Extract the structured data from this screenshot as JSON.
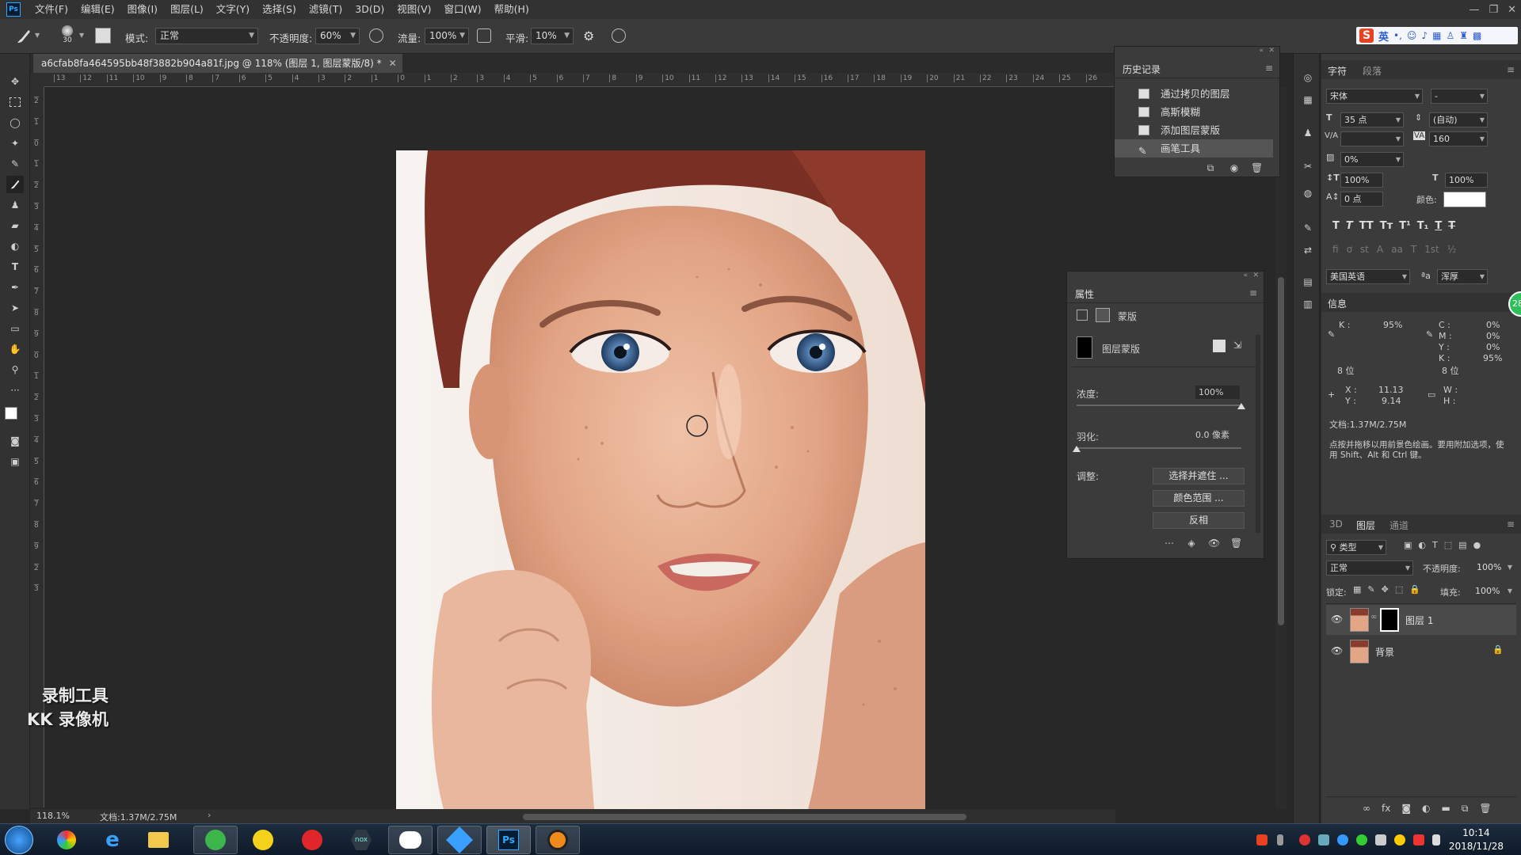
{
  "menubar": {
    "logo": "Ps",
    "items": [
      "文件(F)",
      "编辑(E)",
      "图像(I)",
      "图层(L)",
      "文字(Y)",
      "选择(S)",
      "滤镜(T)",
      "3D(D)",
      "视图(V)",
      "窗口(W)",
      "帮助(H)"
    ],
    "minimize": "—",
    "restore": "❐",
    "close": "✕"
  },
  "options": {
    "brush_size": "30",
    "mode_label": "模式:",
    "mode_value": "正常",
    "opacity_label": "不透明度:",
    "opacity_value": "60%",
    "flow_label": "流量:",
    "flow_value": "100%",
    "smooth_label": "平滑:",
    "smooth_value": "10%"
  },
  "ime": {
    "lang": "英"
  },
  "document": {
    "tab_title": "a6cfab8fa464595bb48f3882b904a81f.jpg @ 118% (图层 1, 图层蒙版/8) *",
    "zoom": "118.1%",
    "doc_size": "文档:1.37M/2.75M"
  },
  "rulers": {
    "h": [
      "13",
      "12",
      "11",
      "10",
      "9",
      "8",
      "7",
      "6",
      "5",
      "4",
      "3",
      "2",
      "1",
      "0",
      "1",
      "2",
      "3",
      "4",
      "5",
      "6",
      "7",
      "8",
      "9",
      "10",
      "11",
      "12",
      "13",
      "14",
      "15",
      "16",
      "17",
      "18",
      "19",
      "20",
      "21",
      "22",
      "23",
      "24",
      "25",
      "26"
    ],
    "v": [
      "2",
      "1",
      "0",
      "1",
      "2",
      "3",
      "4",
      "5",
      "6",
      "7",
      "8",
      "9",
      "0",
      "1",
      "2",
      "3",
      "4",
      "5",
      "6",
      "7",
      "8",
      "9",
      "2",
      "3"
    ]
  },
  "watermark": {
    "line1": "录制工具",
    "line2": "KK 录像机"
  },
  "history": {
    "title": "历史记录",
    "items": [
      "通过拷贝的图层",
      "高斯模糊",
      "添加图层蒙版",
      "画笔工具"
    ]
  },
  "properties": {
    "title": "属性",
    "mask_label": "蒙版",
    "layer_mask_label": "图层蒙版",
    "density_label": "浓度:",
    "density_value": "100%",
    "density_level": 1.0,
    "feather_label": "羽化:",
    "feather_value": "0.0 像素",
    "feather_level": 0.0,
    "adjust_label": "调整:",
    "btn_select_mask": "选择并遮住 ...",
    "btn_color_range": "颜色范围 ...",
    "btn_invert": "反相"
  },
  "character": {
    "tab_char": "字符",
    "tab_para": "段落",
    "font": "宋体",
    "style": "-",
    "size": "35 点",
    "leading": "(自动)",
    "kerning": "",
    "tracking": "160",
    "scale_pct": "0%",
    "vscale": "100%",
    "hscale": "100%",
    "baseline": "0 点",
    "color_label": "颜色:",
    "language": "美国英语",
    "aa_label": "ªa",
    "antialias": "浑厚",
    "text_color": "#ffffff"
  },
  "info": {
    "title": "信息",
    "k_label": "K :",
    "k_value": "95%",
    "c_label": "C :",
    "c_value": "0%",
    "m_label": "M :",
    "m_value": "0%",
    "y_label": "Y :",
    "y_value": "0%",
    "k2_label": "K :",
    "k2_value": "95%",
    "bits1": "8 位",
    "bits2": "8 位",
    "x_label": "X :",
    "x_value": "11.13",
    "ylabel": "Y :",
    "ycoord": "9.14",
    "w_label": "W :",
    "h_label": "H :",
    "doc": "文档:1.37M/2.75M",
    "hint": "点按并拖移以用前景色绘画。要用附加选项，使用 Shift、Alt 和 Ctrl 键。",
    "badge": "28"
  },
  "layers": {
    "tab_3d": "3D",
    "tab_layers": "图层",
    "tab_channels": "通道",
    "filter": "类型",
    "blend": "正常",
    "opacity_label": "不透明度:",
    "opacity_value": "100%",
    "lock_label": "锁定:",
    "fill_label": "填充:",
    "fill_value": "100%",
    "items": [
      "图层 1",
      "背景"
    ]
  },
  "taskbar": {
    "time": "10:14",
    "date": "2018/11/28"
  },
  "colors": {
    "accent": "#31a8ff",
    "panel": "#3b3b3b",
    "bg": "#282828"
  }
}
